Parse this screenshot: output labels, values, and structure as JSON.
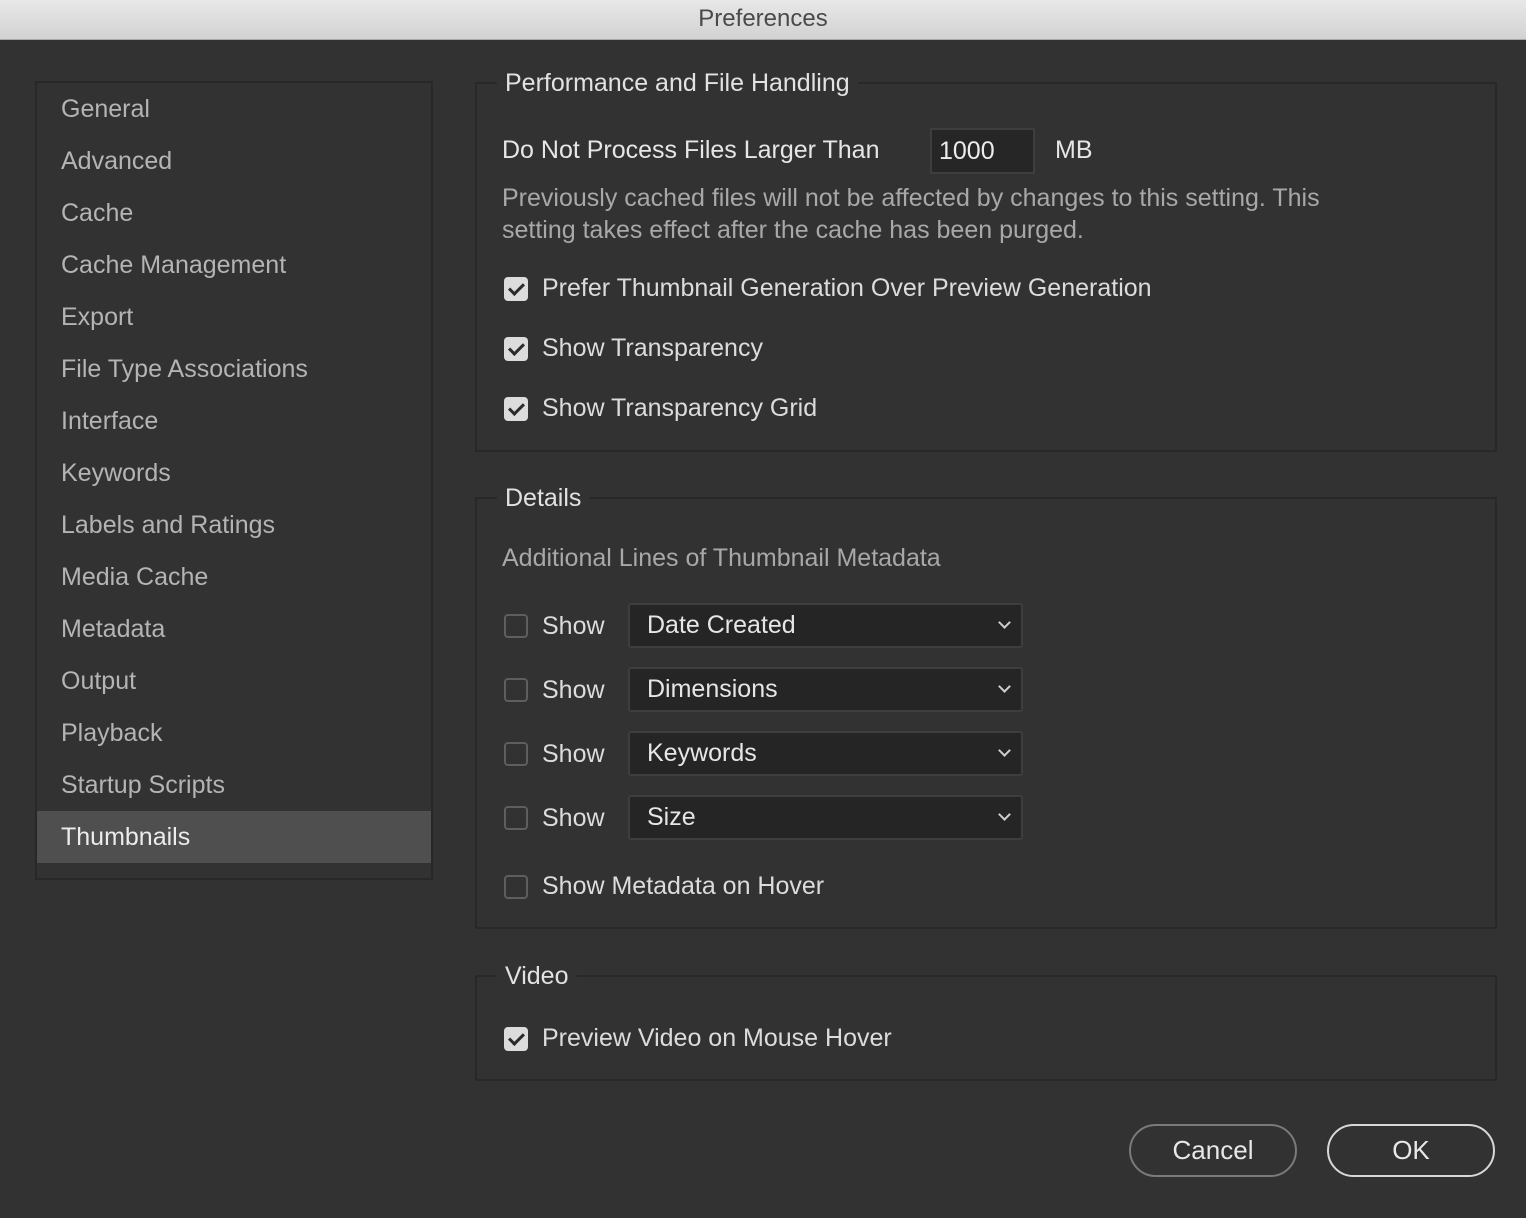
{
  "window": {
    "title": "Preferences"
  },
  "sidebar": {
    "items": [
      "General",
      "Advanced",
      "Cache",
      "Cache Management",
      "Export",
      "File Type Associations",
      "Interface",
      "Keywords",
      "Labels and Ratings",
      "Media Cache",
      "Metadata",
      "Output",
      "Playback",
      "Startup Scripts",
      "Thumbnails"
    ],
    "selected": "Thumbnails"
  },
  "performance": {
    "title": "Performance and File Handling",
    "size_label": "Do Not Process Files Larger Than",
    "size_value": "1000",
    "size_unit": "MB",
    "note_line1": "Previously cached files will not be affected by changes to this setting. This",
    "note_line2": "setting takes effect after the cache has been purged.",
    "options": [
      {
        "label": "Prefer Thumbnail Generation Over Preview Generation",
        "checked": true
      },
      {
        "label": "Show Transparency",
        "checked": true
      },
      {
        "label": "Show Transparency Grid",
        "checked": true
      }
    ]
  },
  "details": {
    "title": "Details",
    "subtitle": "Additional Lines of Thumbnail Metadata",
    "rows": [
      {
        "show_label": "Show",
        "checked": false,
        "value": "Date Created"
      },
      {
        "show_label": "Show",
        "checked": false,
        "value": "Dimensions"
      },
      {
        "show_label": "Show",
        "checked": false,
        "value": "Keywords"
      },
      {
        "show_label": "Show",
        "checked": false,
        "value": "Size"
      }
    ],
    "hover": {
      "label": "Show Metadata on Hover",
      "checked": false
    }
  },
  "video": {
    "title": "Video",
    "option": {
      "label": "Preview Video on Mouse Hover",
      "checked": true
    }
  },
  "buttons": {
    "cancel": "Cancel",
    "ok": "OK"
  }
}
